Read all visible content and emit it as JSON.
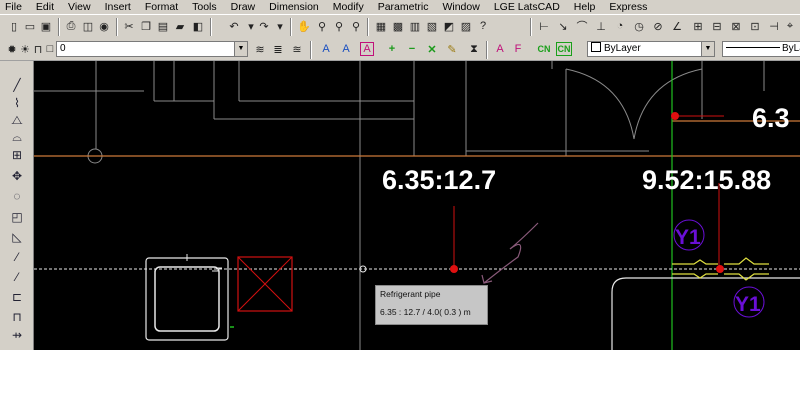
{
  "menubar": {
    "items": [
      "File",
      "Edit",
      "View",
      "Insert",
      "Format",
      "Tools",
      "Draw",
      "Dimension",
      "Modify",
      "Parametric",
      "Window",
      "LGE LatsCAD",
      "Help",
      "Express"
    ]
  },
  "layer_bar": {
    "layer_value": "0",
    "color_value": "ByLayer"
  },
  "canvas": {
    "dim_labels": [
      "6.35:12.7",
      "9.52:15.88",
      "6.3"
    ],
    "unit_marks": [
      "Y1",
      "Y1"
    ],
    "colors": {
      "background": "#000000",
      "grid": "#8a8a8a",
      "wall": "#cc7a3a",
      "dim_line": "#d01010",
      "pipe": "#e8e8e8",
      "fitting": "#e0e040",
      "green": "#20c020",
      "mark": "#6a0fd6"
    }
  },
  "tooltip": {
    "title": "Refrigerant pipe",
    "value": "6.35 : 12.7 / 4.0( 0.3 ) m"
  },
  "icons": {
    "toolbar1": [
      "new-icon",
      "open-icon",
      "save-icon",
      "print-icon",
      "preview-icon",
      "publish-icon",
      "cut-icon",
      "copy-icon",
      "paste-icon",
      "match-icon",
      "block-icon",
      "undo-icon",
      "redo-icon",
      "pan-icon",
      "zoom-realtime-icon",
      "zoom-window-icon",
      "zoom-previous-icon",
      "properties-icon",
      "design-center-icon",
      "tool-palette-icon",
      "sheet-set-icon",
      "markup-icon",
      "calculator-icon",
      "help-icon",
      "linear-dim-icon",
      "aligned-dim-icon",
      "arc-dim-icon",
      "ordinate-dim-icon",
      "radius-dim-icon",
      "jogged-dim-icon",
      "diameter-dim-icon",
      "angular-dim-icon"
    ],
    "left": [
      "line-icon",
      "pline-icon",
      "mirror-icon",
      "offset-icon",
      "array-icon",
      "move-icon",
      "rotate-icon",
      "scale-icon",
      "stretch-icon",
      "trim-icon",
      "extend-icon",
      "break-icon",
      "join-icon",
      "chamfer-icon",
      "fillet-icon"
    ]
  }
}
